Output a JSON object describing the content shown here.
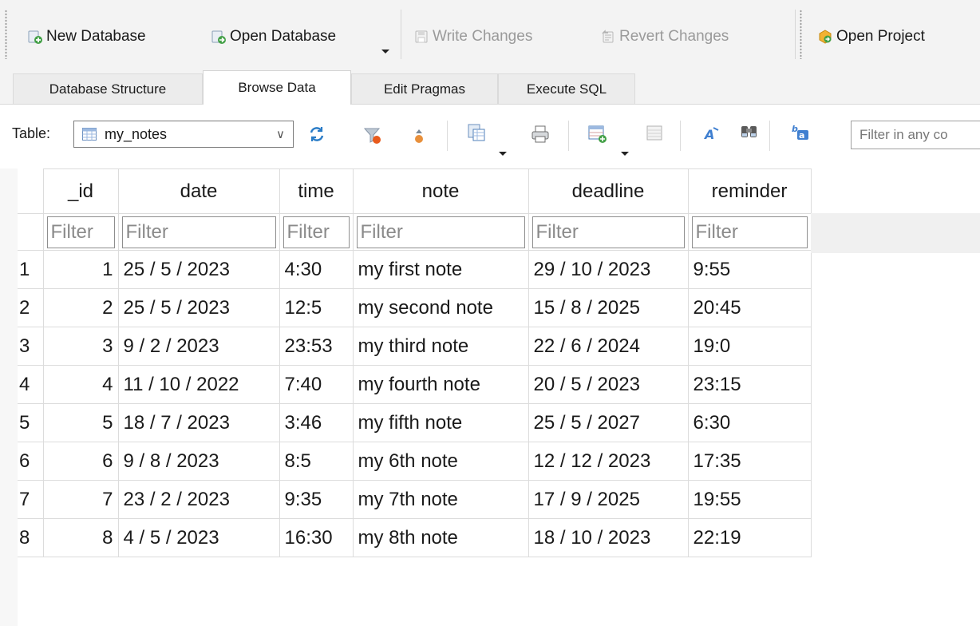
{
  "toolbar": {
    "new_database": "New Database",
    "open_database": "Open Database",
    "write_changes": "Write Changes",
    "revert_changes": "Revert Changes",
    "open_project": "Open Project",
    "icons": {
      "new_database": "new-database-icon",
      "open_database": "open-database-icon",
      "write_changes": "write-changes-icon",
      "revert_changes": "revert-changes-icon",
      "open_project": "open-project-icon"
    }
  },
  "tabs": [
    {
      "label": "Database Structure",
      "active": false
    },
    {
      "label": "Browse Data",
      "active": true
    },
    {
      "label": "Edit Pragmas",
      "active": false
    },
    {
      "label": "Execute SQL",
      "active": false
    }
  ],
  "table_toolbar": {
    "label": "Table:",
    "selected_table": "my_notes",
    "filter_any_placeholder": "Filter in any co"
  },
  "grid": {
    "columns": [
      "_id",
      "date",
      "time",
      "note",
      "deadline",
      "reminder"
    ],
    "filter_placeholder": "Filter",
    "rows": [
      {
        "num": "1",
        "cells": [
          "1",
          "25 / 5 / 2023",
          "4:30",
          "my first note",
          "29 / 10 / 2023",
          "9:55"
        ]
      },
      {
        "num": "2",
        "cells": [
          "2",
          "25 / 5 / 2023",
          "12:5",
          "my second note",
          "15 / 8 / 2025",
          "20:45"
        ]
      },
      {
        "num": "3",
        "cells": [
          "3",
          "9 / 2 / 2023",
          "23:53",
          "my third note",
          "22 / 6 / 2024",
          "19:0"
        ]
      },
      {
        "num": "4",
        "cells": [
          "4",
          "11 / 10 / 2022",
          "7:40",
          "my fourth note",
          "20 / 5 / 2023",
          "23:15"
        ]
      },
      {
        "num": "5",
        "cells": [
          "5",
          "18 / 7 / 2023",
          "3:46",
          "my fifth note",
          "25 / 5 / 2027",
          "6:30"
        ]
      },
      {
        "num": "6",
        "cells": [
          "6",
          "9 / 8 / 2023",
          "8:5",
          "my 6th note",
          "12 / 12 / 2023",
          "17:35"
        ]
      },
      {
        "num": "7",
        "cells": [
          "7",
          "23 / 2 / 2023",
          "9:35",
          "my 7th note",
          "17 / 9 / 2025",
          "19:55"
        ]
      },
      {
        "num": "8",
        "cells": [
          "8",
          "4 / 5 / 2023",
          "16:30",
          "my 8th note",
          "18 / 10 / 2023",
          "22:19"
        ]
      }
    ]
  },
  "colors": {
    "accent_green": "#4caf50",
    "accent_orange": "#f0a030",
    "disabled_text": "#9a9a9a"
  }
}
